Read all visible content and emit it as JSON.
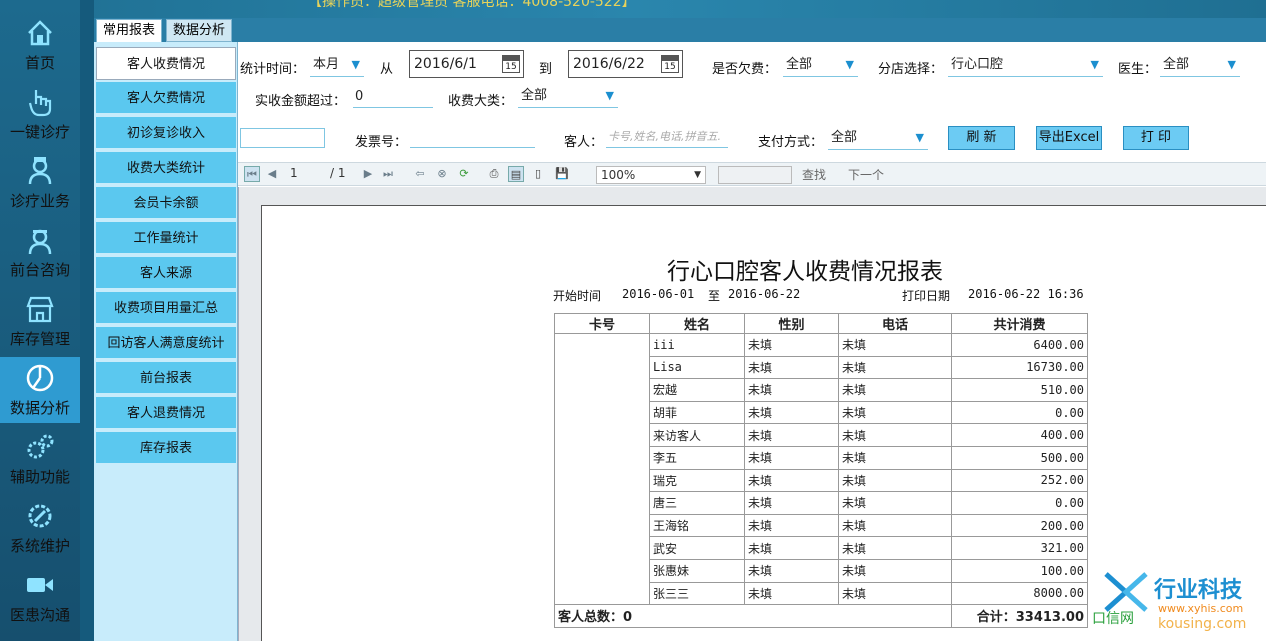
{
  "app": {
    "announcement": "【操作员：超级管理员 客服电话：4008-520-522】"
  },
  "nav": {
    "items": [
      {
        "label": "首页",
        "icon": "home-icon"
      },
      {
        "label": "一键诊疗",
        "icon": "hand-pointer-icon"
      },
      {
        "label": "诊疗业务",
        "icon": "doctor-icon"
      },
      {
        "label": "前台咨询",
        "icon": "nurse-icon"
      },
      {
        "label": "库存管理",
        "icon": "store-icon"
      },
      {
        "label": "数据分析",
        "icon": "pie-chart-icon",
        "active": true
      },
      {
        "label": "辅助功能",
        "icon": "gears-icon"
      },
      {
        "label": "系统维护",
        "icon": "gear-wrench-icon"
      },
      {
        "label": "医患沟通",
        "icon": "video-camera-icon"
      }
    ]
  },
  "tabs": [
    "常用报表",
    "数据分析"
  ],
  "reports": [
    "客人收费情况",
    "客人欠费情况",
    "初诊复诊收入",
    "收费大类统计",
    "会员卡余额",
    "工作量统计",
    "客人来源",
    "收费项目用量汇总",
    "回访客人满意度统计",
    "前台报表",
    "客人退费情况",
    "库存报表"
  ],
  "filters": {
    "period_label": "统计时间：",
    "period_value": "本月",
    "from_label": "从",
    "from_date": "2016/6/1",
    "to_label": "到",
    "to_date": "2016/6/22",
    "calendar_text": "15",
    "arrears_label": "是否欠费：",
    "arrears_value": "全部",
    "branch_label": "分店选择：",
    "branch_value": "行心口腔",
    "doctor_label": "医生：",
    "doctor_value": "全部",
    "amount_label": "实收金额超过：",
    "amount_value": "0",
    "category_label": "收费大类：",
    "category_value": "全部",
    "invoice_label": "发票号：",
    "invoice_value": "",
    "customer_label": "客人：",
    "customer_placeholder": "卡号,姓名,电话,拼音五.",
    "payment_label": "支付方式：",
    "payment_value": "全部",
    "refresh_button": "刷 新",
    "excel_button": "导出Excel",
    "print_button": "打 印"
  },
  "viewer": {
    "page_current": "1",
    "page_total": "/ 1",
    "zoom": "100%",
    "find_label": "查找",
    "next_label": "下一个",
    "search_value": ""
  },
  "report": {
    "title": "行心口腔客人收费情况报表",
    "start_label": "开始时间",
    "start_date": "2016-06-01",
    "to_label": "至",
    "end_date": "2016-06-22",
    "print_label": "打印日期",
    "print_date": "2016-06-22 16:36",
    "columns": [
      "卡号",
      "姓名",
      "性别",
      "电话",
      "共计消费"
    ],
    "rows": [
      {
        "card": "",
        "name": "iii",
        "gender": "未填",
        "phone": "未填",
        "total": "6400.00"
      },
      {
        "card": "",
        "name": "Lisa",
        "gender": "未填",
        "phone": "未填",
        "total": "16730.00"
      },
      {
        "card": "",
        "name": "宏越",
        "gender": "未填",
        "phone": "未填",
        "total": "510.00"
      },
      {
        "card": "",
        "name": "胡菲",
        "gender": "未填",
        "phone": "未填",
        "total": "0.00"
      },
      {
        "card": "",
        "name": "来访客人",
        "gender": "未填",
        "phone": "未填",
        "total": "400.00"
      },
      {
        "card": "",
        "name": "李五",
        "gender": "未填",
        "phone": "未填",
        "total": "500.00"
      },
      {
        "card": "",
        "name": "瑞克",
        "gender": "未填",
        "phone": "未填",
        "total": "252.00"
      },
      {
        "card": "",
        "name": "唐三",
        "gender": "未填",
        "phone": "未填",
        "total": "0.00"
      },
      {
        "card": "",
        "name": "王海铭",
        "gender": "未填",
        "phone": "未填",
        "total": "200.00"
      },
      {
        "card": "",
        "name": "武安",
        "gender": "未填",
        "phone": "未填",
        "total": "321.00"
      },
      {
        "card": "",
        "name": "张惠妹",
        "gender": "未填",
        "phone": "未填",
        "total": "100.00"
      },
      {
        "card": "",
        "name": "张三三",
        "gender": "未填",
        "phone": "未填",
        "total": "8000.00"
      }
    ],
    "footer_count": "客人总数：0",
    "footer_total": "合计：33413.00"
  },
  "watermark": {
    "brand": "行业科技",
    "url": "www.xyhis.com",
    "site": "口信网",
    "site_url": "kousing.com"
  },
  "colors": {
    "accent": "#5bc8ef",
    "nav_bg": "#1d6a8e",
    "nav_active": "#2f9bd1",
    "button_bg": "#6ccbf3"
  }
}
